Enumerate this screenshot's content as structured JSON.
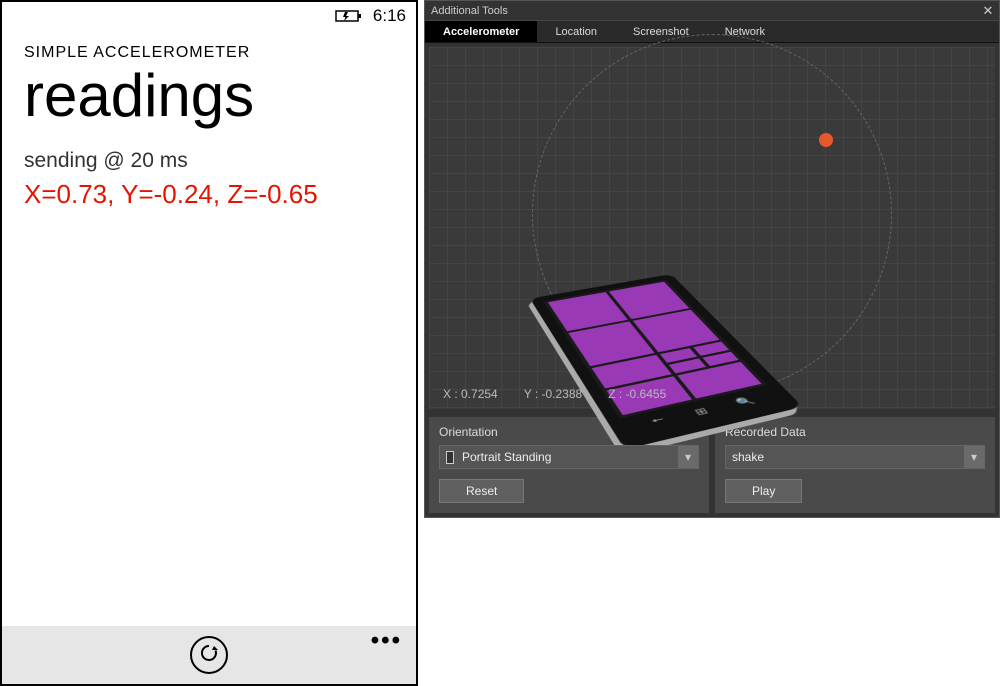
{
  "phone": {
    "status": {
      "time": "6:16"
    },
    "app_title": "SIMPLE ACCELEROMETER",
    "page_title": "readings",
    "sending_text": "sending @ 20 ms",
    "reading": {
      "x": "0.73",
      "y": "-0.24",
      "z": "-0.65"
    },
    "readings_composed": "X=0.73, Y=-0.24, Z=-0.65"
  },
  "tools": {
    "window_title": "Additional Tools",
    "tabs": [
      {
        "label": "Accelerometer",
        "active": true
      },
      {
        "label": "Location"
      },
      {
        "label": "Screenshot"
      },
      {
        "label": "Network"
      }
    ],
    "readout": {
      "x": "X : 0.7254",
      "y": "Y : -0.2388",
      "z": "Z : -0.6455"
    },
    "orientation": {
      "label": "Orientation",
      "selected": "Portrait Standing",
      "reset_label": "Reset"
    },
    "recorded": {
      "label": "Recorded Data",
      "selected": "shake",
      "play_label": "Play"
    }
  }
}
